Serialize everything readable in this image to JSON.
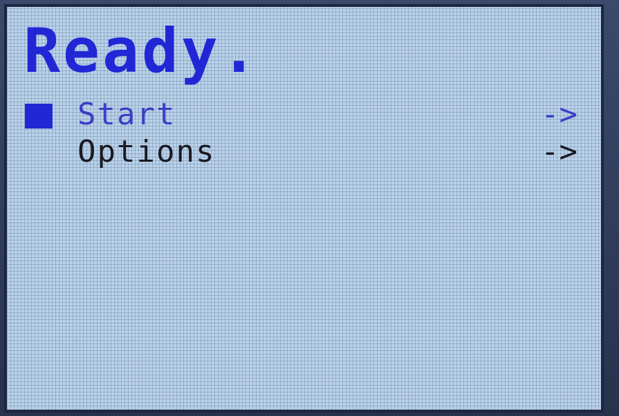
{
  "screen": {
    "title": "Ready.",
    "menu": {
      "items": [
        {
          "label": "Start",
          "arrow": "->",
          "selected": true
        },
        {
          "label": "Options",
          "arrow": "->",
          "selected": false
        }
      ]
    }
  },
  "colors": {
    "lcd_background": "#b9d2ea",
    "highlight_blue": "#2227d6",
    "selected_text": "#3a3fc6",
    "text_dark": "#1a1a22",
    "bezel": "#2d3a57"
  }
}
